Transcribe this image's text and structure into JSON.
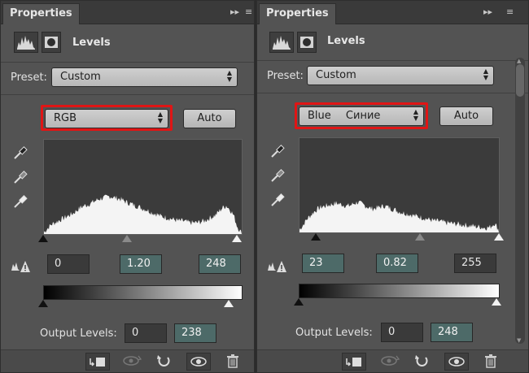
{
  "panels": [
    {
      "tab_label": "Properties",
      "collapse_glyph": "▸▸",
      "menu_glyph": "≡",
      "adjustment_title": "Levels",
      "preset_label": "Preset:",
      "preset_value": "Custom",
      "channel_value": "RGB",
      "auto_label": "Auto",
      "input_black": "0",
      "input_gamma": "1.20",
      "input_white": "248",
      "output_label": "Output Levels:",
      "output_black": "0",
      "output_white": "238",
      "histogram_profile": [
        2,
        6,
        10,
        12,
        14,
        16,
        18,
        20,
        22,
        25,
        28,
        30,
        31,
        33,
        35,
        37,
        38,
        39,
        40,
        39,
        38,
        37,
        35,
        33,
        32,
        30,
        29,
        27,
        26,
        24,
        22,
        21,
        19,
        18,
        17,
        16,
        15,
        14,
        14,
        13,
        12,
        12,
        12,
        13,
        14,
        16,
        18,
        20,
        24,
        28,
        30,
        26,
        20,
        8,
        2
      ]
    },
    {
      "tab_label": "Properties",
      "collapse_glyph": "▸▸",
      "menu_glyph": "≡",
      "adjustment_title": "Levels",
      "preset_label": "Preset:",
      "preset_value": "Custom",
      "channel_value": "Blue",
      "channel_annotation": "Синие",
      "auto_label": "Auto",
      "input_black": "23",
      "input_gamma": "0.82",
      "input_white": "255",
      "output_label": "Output Levels:",
      "output_black": "0",
      "output_white": "248",
      "histogram_profile": [
        3,
        8,
        14,
        18,
        22,
        25,
        27,
        28,
        29,
        30,
        31,
        30,
        29,
        28,
        29,
        31,
        32,
        30,
        28,
        26,
        25,
        26,
        27,
        28,
        27,
        25,
        24,
        22,
        21,
        20,
        19,
        18,
        17,
        16,
        15,
        14,
        13,
        12,
        12,
        11,
        10,
        10,
        9,
        9,
        8,
        8,
        7,
        7,
        6,
        6,
        5,
        5,
        6,
        10,
        4
      ]
    }
  ]
}
